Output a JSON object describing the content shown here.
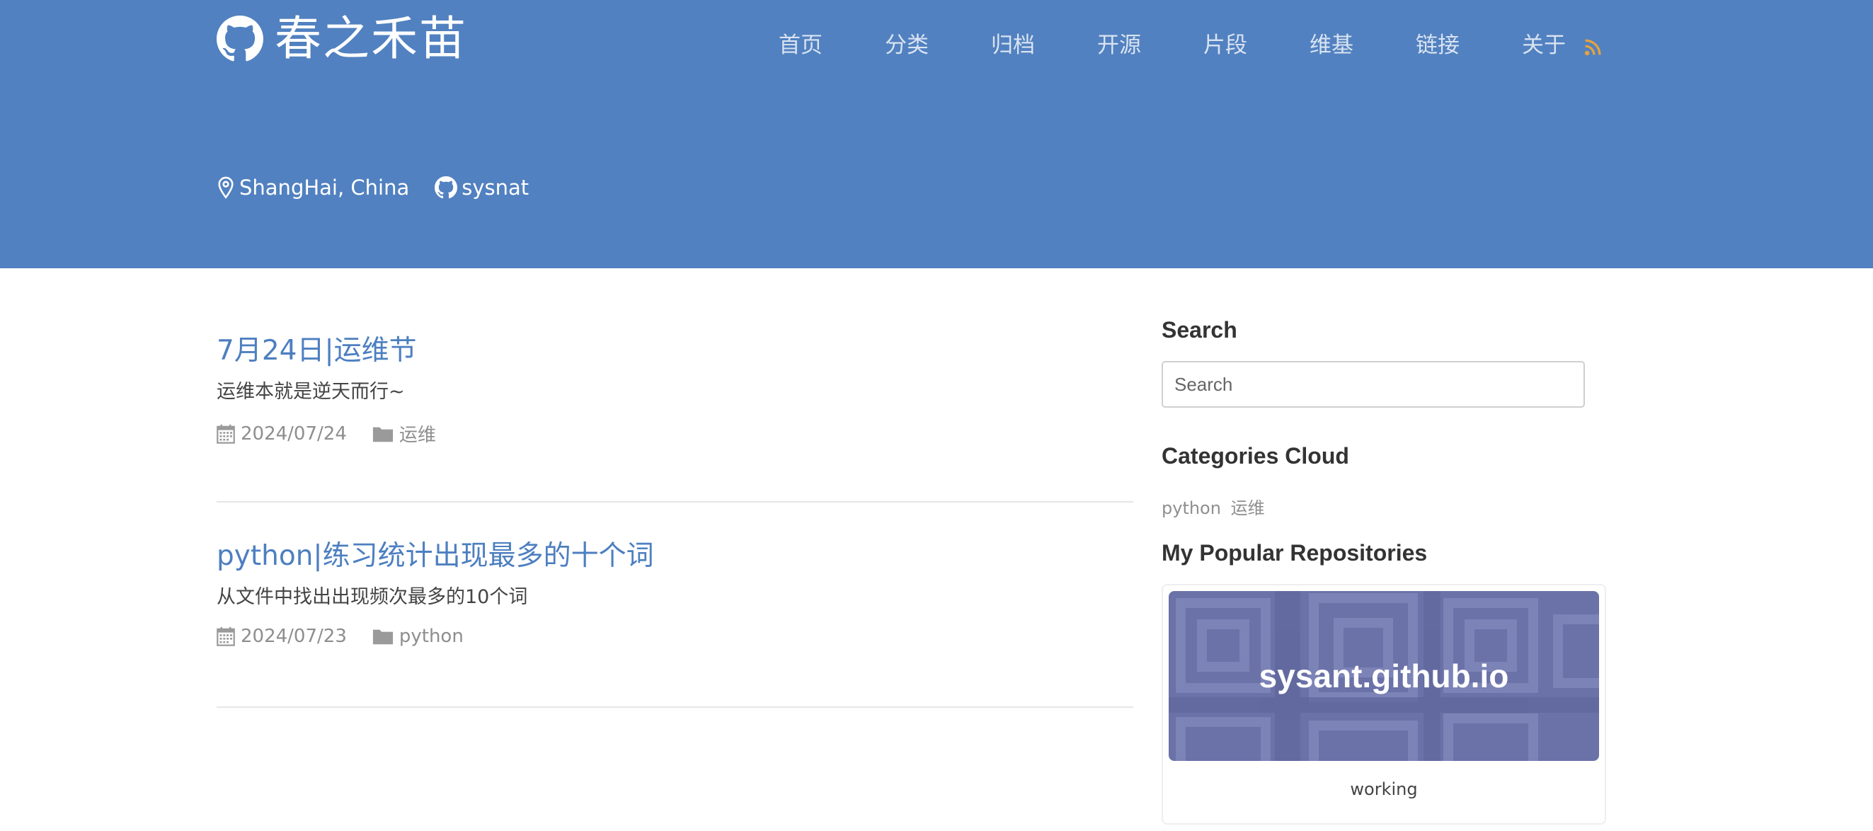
{
  "site": {
    "title": "春之禾苗",
    "nav": [
      "首页",
      "分类",
      "归档",
      "开源",
      "片段",
      "维基",
      "链接",
      "关于"
    ],
    "location": "ShangHai, China",
    "github_user": "sysnat"
  },
  "posts": [
    {
      "title": "7月24日|运维节",
      "summary": "运维本就是逆天而行~",
      "date": "2024/07/24",
      "category": "运维"
    },
    {
      "title": "python|练习统计出现最多的十个词",
      "summary": "从文件中找出出现频次最多的10个词",
      "date": "2024/07/23",
      "category": "python"
    }
  ],
  "sidebar": {
    "search_heading": "Search",
    "search_placeholder": "Search",
    "categories_heading": "Categories Cloud",
    "categories": [
      "python",
      "运维"
    ],
    "repos_heading": "My Popular Repositories",
    "repo": {
      "name": "sysant.github.io",
      "description": "working"
    }
  },
  "colors": {
    "header_bg": "#5181c0",
    "link": "#4d7fc0",
    "rss": "#e8a23b",
    "repo_banner": "#6b72a8"
  },
  "icons": [
    "github-icon",
    "rss-icon",
    "location-pin-icon",
    "calendar-icon",
    "folder-icon"
  ]
}
